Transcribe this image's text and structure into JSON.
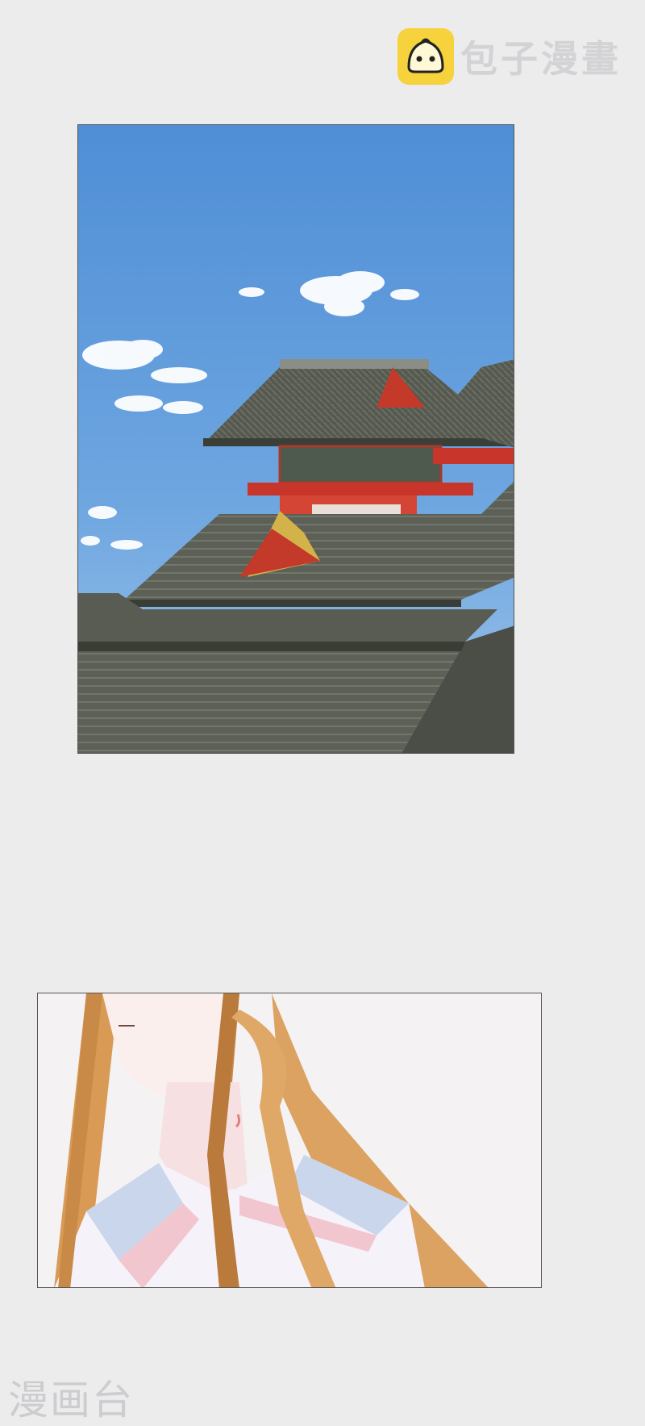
{
  "watermark_top": {
    "brand": "包子漫畫",
    "logo_icon": "bun-mascot-icon",
    "logo_color": "#f6d23c"
  },
  "panels": [
    {
      "scene": "palace-rooftops-under-blue-sky",
      "sky_color": "#5d97d8"
    },
    {
      "scene": "long-haired-girl-closeup",
      "hair_color": "#d8a25e"
    }
  ],
  "watermark_bottom": {
    "brand": "漫画台"
  }
}
